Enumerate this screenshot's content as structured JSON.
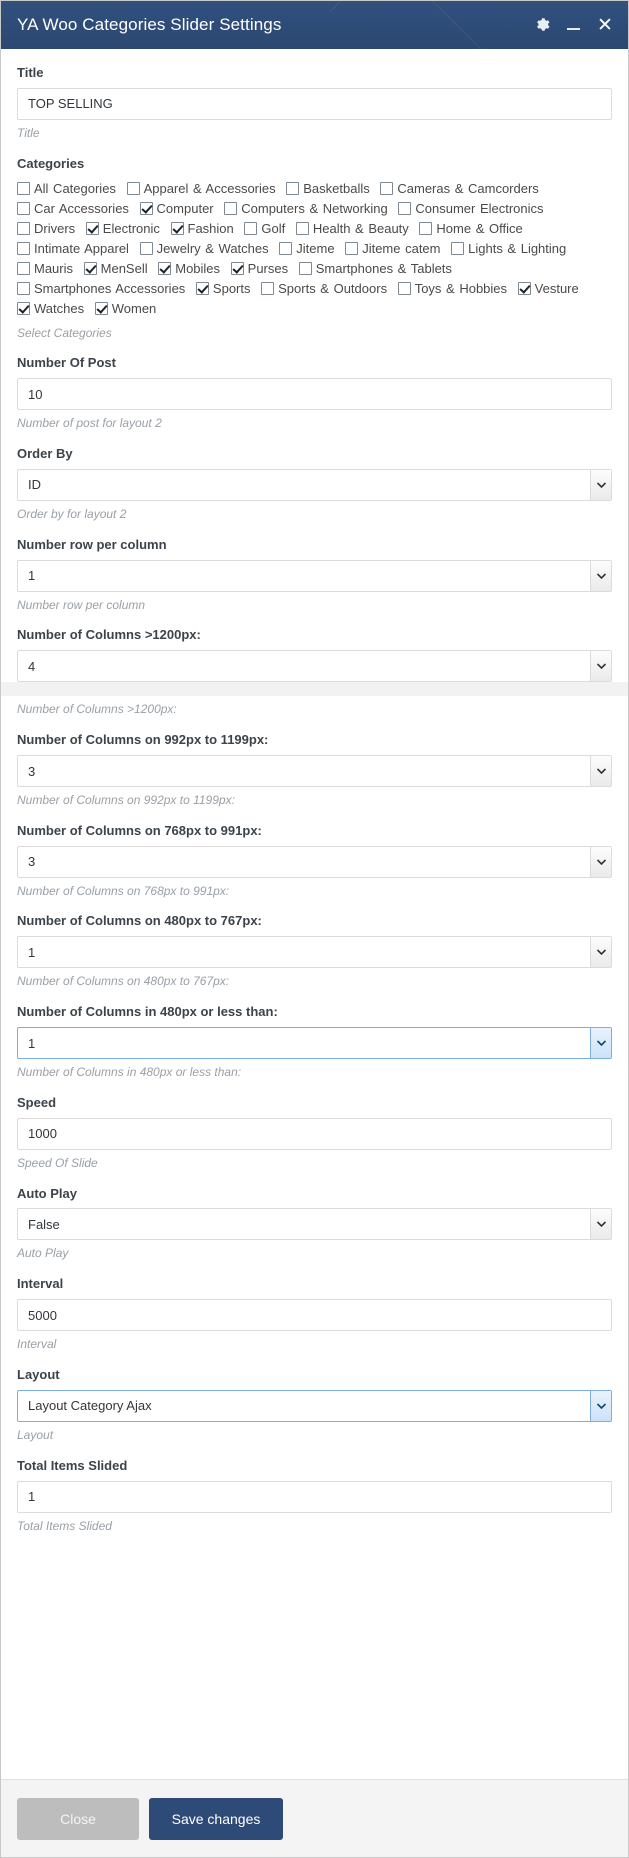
{
  "window": {
    "title": "YA Woo Categories Slider Settings",
    "icons": {
      "settings": "gear-icon",
      "minimize": "minimize-icon",
      "close": "close-icon"
    }
  },
  "form": {
    "title": {
      "label": "Title",
      "value": "TOP SELLING",
      "help": "Title"
    },
    "categories": {
      "label": "Categories",
      "help": "Select Categories",
      "items": [
        {
          "label": "All Categories",
          "checked": false
        },
        {
          "label": "Apparel & Accessories",
          "checked": false
        },
        {
          "label": "Basketballs",
          "checked": false
        },
        {
          "label": "Cameras & Camcorders",
          "checked": false
        },
        {
          "label": "Car Accessories",
          "checked": false
        },
        {
          "label": "Computer",
          "checked": true
        },
        {
          "label": "Computers & Networking",
          "checked": false
        },
        {
          "label": "Consumer Electronics",
          "checked": false
        },
        {
          "label": "Drivers",
          "checked": false
        },
        {
          "label": "Electronic",
          "checked": true
        },
        {
          "label": "Fashion",
          "checked": true
        },
        {
          "label": "Golf",
          "checked": false
        },
        {
          "label": "Health & Beauty",
          "checked": false
        },
        {
          "label": "Home & Office",
          "checked": false
        },
        {
          "label": "Intimate Apparel",
          "checked": false
        },
        {
          "label": "Jewelry & Watches",
          "checked": false
        },
        {
          "label": "Jiteme",
          "checked": false
        },
        {
          "label": "Jiteme catem",
          "checked": false
        },
        {
          "label": "Lights & Lighting",
          "checked": false
        },
        {
          "label": "Mauris",
          "checked": false
        },
        {
          "label": "MenSell",
          "checked": true
        },
        {
          "label": "Mobiles",
          "checked": true
        },
        {
          "label": "Purses",
          "checked": true
        },
        {
          "label": "Smartphones & Tablets",
          "checked": false
        },
        {
          "label": "Smartphones Accessories",
          "checked": false
        },
        {
          "label": "Sports",
          "checked": true
        },
        {
          "label": "Sports & Outdoors",
          "checked": false
        },
        {
          "label": "Toys & Hobbies",
          "checked": false
        },
        {
          "label": "Vesture",
          "checked": true
        },
        {
          "label": "Watches",
          "checked": true
        },
        {
          "label": "Women",
          "checked": true
        }
      ]
    },
    "number_of_post": {
      "label": "Number Of Post",
      "value": "10",
      "help": "Number of post for layout 2"
    },
    "order_by": {
      "label": "Order By",
      "value": "ID",
      "help": "Order by for layout 2"
    },
    "number_row_per_column": {
      "label": "Number row per column",
      "value": "1",
      "help": "Number row per column"
    },
    "columns_1200": {
      "label": "Number of Columns >1200px:",
      "value": "4",
      "help": "Number of Columns >1200px:"
    },
    "columns_992_1199": {
      "label": "Number of Columns on 992px to 1199px:",
      "value": "3",
      "help": "Number of Columns on 992px to 1199px:"
    },
    "columns_768_991": {
      "label": "Number of Columns on 768px to 991px:",
      "value": "3",
      "help": "Number of Columns on 768px to 991px:"
    },
    "columns_480_767": {
      "label": "Number of Columns on 480px to 767px:",
      "value": "1",
      "help": "Number of Columns on 480px to 767px:"
    },
    "columns_480_less": {
      "label": "Number of Columns in 480px or less than:",
      "value": "1",
      "help": "Number of Columns in 480px or less than:"
    },
    "speed": {
      "label": "Speed",
      "value": "1000",
      "help": "Speed Of Slide"
    },
    "auto_play": {
      "label": "Auto Play",
      "value": "False",
      "help": "Auto Play"
    },
    "interval": {
      "label": "Interval",
      "value": "5000",
      "help": "Interval"
    },
    "layout": {
      "label": "Layout",
      "value": "Layout Category Ajax",
      "help": "Layout"
    },
    "total_items_slided": {
      "label": "Total Items Slided",
      "value": "1",
      "help": "Total Items Slided"
    }
  },
  "footer": {
    "close_label": "Close",
    "save_label": "Save changes"
  },
  "colors": {
    "titlebar": "#2e4a77",
    "primary_button": "#2e4a77",
    "secondary_button": "#bdbdbd"
  }
}
